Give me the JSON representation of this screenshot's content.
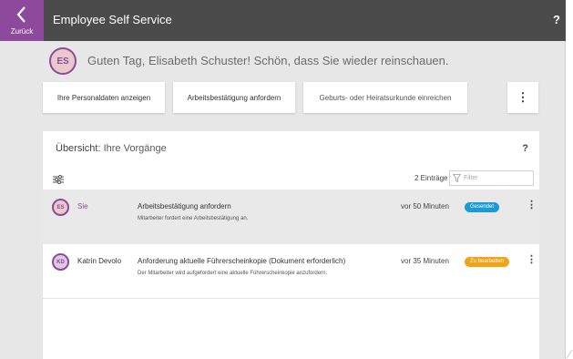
{
  "header": {
    "back_label": "Zurück",
    "title": "Employee Self Service",
    "help": "?"
  },
  "greeting": {
    "avatar_initials": "ES",
    "text": "Guten Tag, Elisabeth Schuster! Schön, dass Sie wieder reinschauen."
  },
  "actions": [
    {
      "label": "Ihre Personaldaten anzeigen"
    },
    {
      "label": "Arbeitsbestätigung anfordern"
    },
    {
      "label": "Geburts- oder Heiratsurkunde einreichen"
    },
    {
      "label": "⋮"
    }
  ],
  "overview": {
    "title_bold": "Übersicht",
    "title_rest": ": Ihre Vorgänge",
    "help": "?",
    "entries": "2 Einträge",
    "filter_placeholder": "Filter",
    "rows": [
      {
        "initials": "ES",
        "person": "Sie",
        "title": "Arbeitsbestätigung anfordern",
        "description": "Mitarbeiter fordert eine Arbeitsbestätigung an.",
        "time": "vor 50 Minuten",
        "status": "Gesendet",
        "status_color": "#1a9bd7",
        "menu": "⋮"
      },
      {
        "initials": "KD",
        "person": "Katrin Devolo",
        "title": "Anforderung aktuelle Führerscheinkopie (Dokument erforderlich)",
        "description": "Der Mitarbeiter wird aufgefordert eine aktuelle Führerscheinkopie anzufordern.",
        "time": "vor 35 Minuten",
        "status": "Zu bearbeiten",
        "status_color": "#f0a316",
        "menu": "⋮"
      }
    ]
  },
  "colors": {
    "accent": "#8d4a9c",
    "topbar": "#4b4b4b",
    "background": "#e7e7e7"
  }
}
